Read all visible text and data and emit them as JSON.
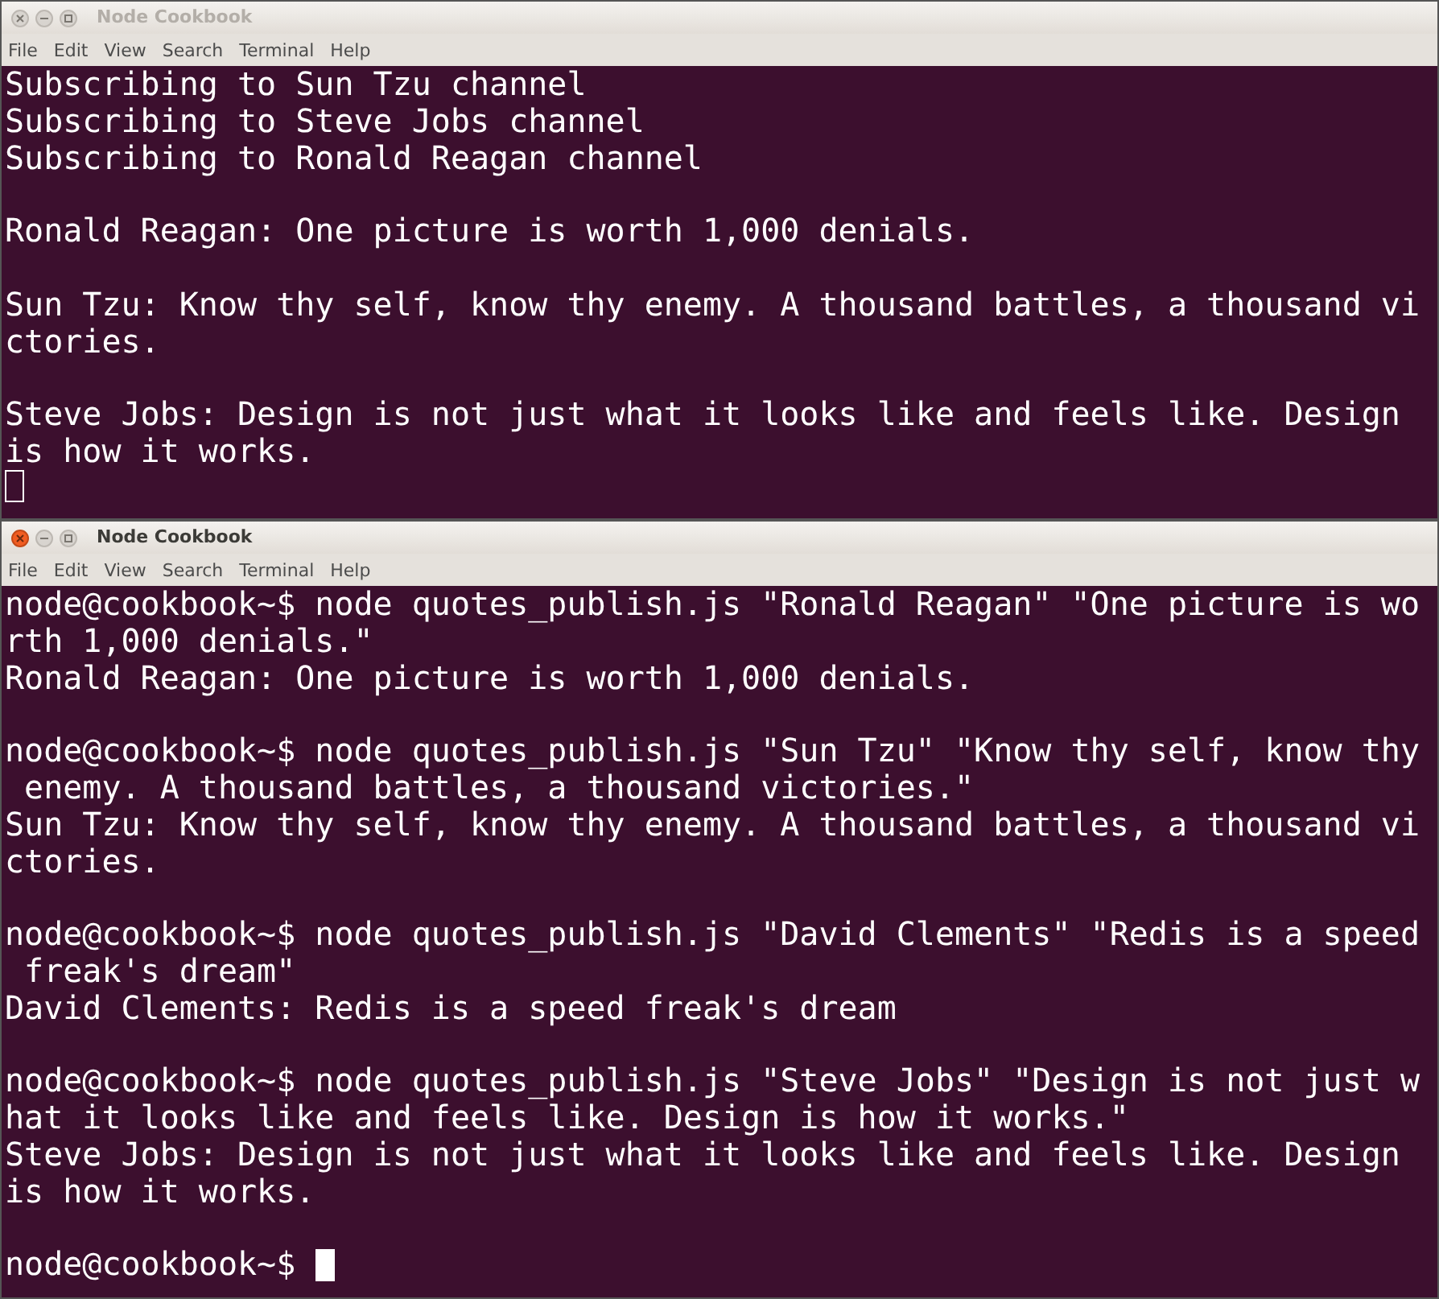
{
  "windows": [
    {
      "title": "Node Cookbook",
      "active": false,
      "menu": [
        "File",
        "Edit",
        "View",
        "Search",
        "Terminal",
        "Help"
      ],
      "blocks": [
        [
          "Subscribing to Sun Tzu channel",
          "Subscribing to Steve Jobs channel",
          "Subscribing to Ronald Reagan channel"
        ],
        [
          "Ronald Reagan: One picture is worth 1,000 denials."
        ],
        [
          "Sun Tzu: Know thy self, know thy enemy. A thousand battles, a thousand vi",
          "ctories."
        ],
        [
          "Steve Jobs: Design is not just what it looks like and feels like. Design",
          "is how it works."
        ]
      ]
    },
    {
      "title": "Node Cookbook",
      "active": true,
      "menu": [
        "File",
        "Edit",
        "View",
        "Search",
        "Terminal",
        "Help"
      ],
      "blocks": [
        [
          "node@cookbook~$ node quotes_publish.js \"Ronald Reagan\" \"One picture is wo",
          "rth 1,000 denials.\"",
          "Ronald Reagan: One picture is worth 1,000 denials."
        ],
        [
          "node@cookbook~$ node quotes_publish.js \"Sun Tzu\" \"Know thy self, know thy",
          " enemy. A thousand battles, a thousand victories.\"",
          "Sun Tzu: Know thy self, know thy enemy. A thousand battles, a thousand vi",
          "ctories."
        ],
        [
          "node@cookbook~$ node quotes_publish.js \"David Clements\" \"Redis is a speed",
          " freak's dream\"",
          "David Clements: Redis is a speed freak's dream"
        ],
        [
          "node@cookbook~$ node quotes_publish.js \"Steve Jobs\" \"Design is not just w",
          "hat it looks like and feels like. Design is how it works.\"",
          "Steve Jobs: Design is not just what it looks like and feels like. Design",
          "is how it works."
        ],
        [
          "node@cookbook~$ "
        ]
      ]
    }
  ]
}
